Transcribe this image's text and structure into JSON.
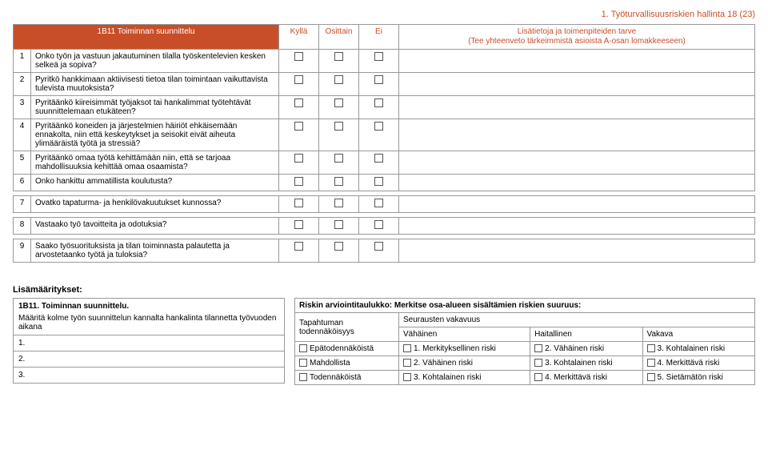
{
  "page_header": "1. Työturvallisuusriskien hallinta 18 (23)",
  "section": {
    "code": "1B11 Toiminnan suunnittelu",
    "cols": {
      "yes": "Kyllä",
      "partial": "Osittain",
      "no": "Ei"
    },
    "notes_head_line1": "Lisätietoja ja toimenpiteiden tarve",
    "notes_head_line2": "(Tee yhteenveto tärkeimmistä asioista A-osan lomakkeeseen)",
    "rows": [
      {
        "n": "1",
        "q": "Onko työn ja vastuun jakautuminen tilalla työskentelevien kesken selkeä ja sopiva?"
      },
      {
        "n": "2",
        "q": "Pyritkö hankkimaan aktiivisesti tietoa tilan toimintaan vaikuttavista tulevista muutoksista?"
      },
      {
        "n": "3",
        "q": "Pyritäänkö kiireisimmät työjaksot tai hankalimmat työtehtävät suunnittelemaan etukäteen?"
      },
      {
        "n": "4",
        "q": "Pyritäänkö koneiden ja järjestelmien häiriöt ehkäisemään ennakolta, niin että keskeytykset ja seisokit eivät aiheuta ylimääräistä työtä ja stressiä?"
      },
      {
        "n": "5",
        "q": "Pyritäänkö omaa työtä kehittämään niin, että se tarjoaa mahdollisuuksia kehittää omaa osaamista?"
      },
      {
        "n": "6",
        "q": "Onko hankittu ammatillista koulutusta?"
      },
      {
        "n": "7",
        "q": "Ovatko tapaturma- ja henkilövakuutukset kunnossa?"
      },
      {
        "n": "8",
        "q": "Vastaako työ tavoitteita ja odotuksia?"
      },
      {
        "n": "9",
        "q": "Saako työsuorituksista ja tilan toiminnasta palautetta ja arvostetaanko työtä ja tuloksia?"
      }
    ]
  },
  "defs": {
    "title": "Lisämääritykset:",
    "box_head": "1B11. Toiminnan suunnittelu.",
    "box_desc": "Määritä kolme työn suunnittelun kannalta hankalinta tilannetta työvuoden aikana",
    "items": [
      "1.",
      "2.",
      "3."
    ]
  },
  "risk": {
    "title": "Riskin arviointitaulukko: Merkitse osa-alueen sisältämien riskien suuruus:",
    "prob_label": "Tapahtuman todennäköisyys",
    "sev_label": "Seurausten vakavuus",
    "sev_cols": [
      "Vähäinen",
      "Haitallinen",
      "Vakava"
    ],
    "rows": [
      {
        "p": "Epätodennäköistä",
        "c": [
          "1. Merkityksellinen riski",
          "2. Vähäinen riski",
          "3. Kohtalainen riski"
        ]
      },
      {
        "p": "Mahdollista",
        "c": [
          "2. Vähäinen riski",
          "3. Kohtalainen riski",
          "4. Merkittävä riski"
        ]
      },
      {
        "p": "Todennäköistä",
        "c": [
          "3. Kohtalainen riski",
          "4. Merkittävä riski",
          "5. Sietämätön riski"
        ]
      }
    ]
  }
}
